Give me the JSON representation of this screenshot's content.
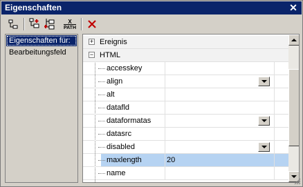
{
  "window": {
    "title": "Eigenschaften",
    "close_glyph": "✕"
  },
  "toolbar": {
    "buttons": [
      {
        "icon": "tree-view-icon"
      },
      {
        "icon": "add-before-icon"
      },
      {
        "icon": "add-after-icon"
      },
      {
        "icon": "xpath-icon",
        "label_top": "X",
        "label_bottom": "PATH"
      },
      {
        "icon": "delete-icon"
      }
    ]
  },
  "left_panel": {
    "items": [
      {
        "label": "Eigenschaften für:"
      },
      {
        "label": "Bearbeitungsfeld"
      }
    ]
  },
  "grid": {
    "groups": [
      {
        "label": "Ereignis",
        "expander": "+"
      },
      {
        "label": "HTML",
        "expander": "−"
      }
    ],
    "rows": [
      {
        "name": "accesskey",
        "value": ""
      },
      {
        "name": "align",
        "value": ""
      },
      {
        "name": "alt",
        "value": ""
      },
      {
        "name": "datafld",
        "value": ""
      },
      {
        "name": "dataformatas",
        "value": ""
      },
      {
        "name": "datasrc",
        "value": ""
      },
      {
        "name": "disabled",
        "value": ""
      },
      {
        "name": "maxlength",
        "value": "20"
      },
      {
        "name": "name",
        "value": ""
      }
    ]
  }
}
